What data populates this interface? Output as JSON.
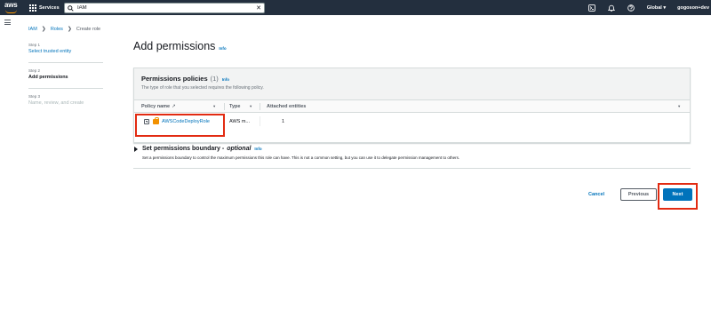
{
  "nav": {
    "logo_text": "aws",
    "services_label": "Services",
    "search_value": "IAM",
    "search_clear": "✕",
    "region": "Global ▾",
    "account": "gogoson+dev"
  },
  "breadcrumb": {
    "items": [
      "IAM",
      "Roles",
      "Create role"
    ],
    "separator": "❯"
  },
  "steps": [
    {
      "number": "Step 1",
      "title": "Select trusted entity",
      "state": "link"
    },
    {
      "number": "Step 2",
      "title": "Add permissions",
      "state": "current"
    },
    {
      "number": "Step 3",
      "title": "Name, review, and create",
      "state": "disabled"
    }
  ],
  "page": {
    "title": "Add permissions",
    "info": "Info"
  },
  "permissions": {
    "title": "Permissions policies",
    "count": "(1)",
    "info": "Info",
    "description": "The type of role that you selected requires the following policy.",
    "columns": {
      "policy_name": "Policy name",
      "external_icon": "↗",
      "type": "Type",
      "attached_entities": "Attached entities",
      "sort": "▾"
    },
    "rows": [
      {
        "name": "AWSCodeDeployRole",
        "type": "AWS m...",
        "attached": "1"
      }
    ]
  },
  "boundary": {
    "title": "Set permissions boundary -",
    "optional": "optional",
    "info": "Info",
    "description": "Set a permissions boundary to control the maximum permissions this role can have. This is not a common setting, but you can use it to delegate permission management to others."
  },
  "actions": {
    "cancel": "Cancel",
    "previous": "Previous",
    "next": "Next"
  },
  "colors": {
    "nav_bg": "#232f3e",
    "link": "#0073bb",
    "primary_button": "#0073bb",
    "highlight": "#e22b12",
    "policy_icon": "#f29100"
  },
  "icons": [
    "aws-logo",
    "grid-icon",
    "search-icon",
    "close-icon",
    "cloudshell-icon",
    "bell-icon",
    "help-icon",
    "menu-icon",
    "external-link-icon",
    "expand-icon",
    "policy-icon",
    "caret-right-icon"
  ]
}
